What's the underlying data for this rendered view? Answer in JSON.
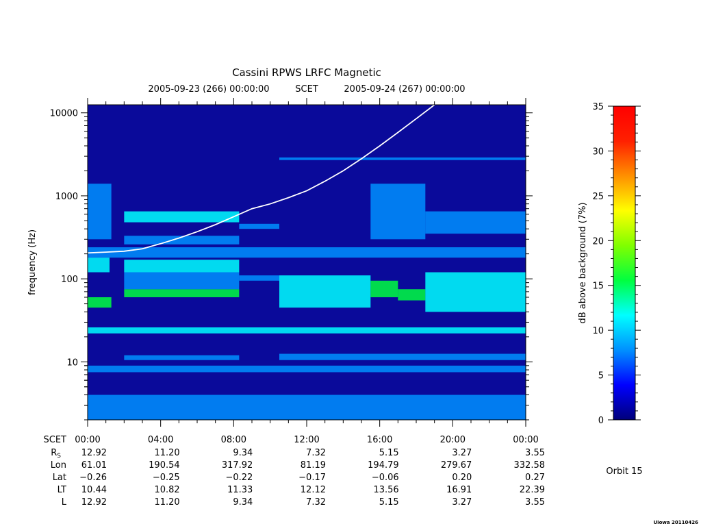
{
  "chart_data": {
    "type": "heatmap",
    "title": "Cassini RPWS LRFC Magnetic",
    "subtitle": {
      "start": "2005-09-23 (266) 00:00:00",
      "mid": "SCET",
      "end": "2005-09-24 (267) 00:00:00"
    },
    "ylabel": "frequency (Hz)",
    "yscale": "log",
    "ylim": [
      2,
      12500
    ],
    "y_ticks": [
      {
        "value": 10,
        "label": "10"
      },
      {
        "value": 100,
        "label": "100"
      },
      {
        "value": 1000,
        "label": "1000"
      },
      {
        "value": 10000,
        "label": "10000"
      }
    ],
    "xlim_hours": [
      0,
      24
    ],
    "colorbar": {
      "label": "dB above background (7%)",
      "range": [
        0,
        35
      ],
      "ticks": [
        "0",
        "5",
        "10",
        "15",
        "20",
        "25",
        "30",
        "35"
      ],
      "colors": [
        "#00007a",
        "#0000ff",
        "#0090ff",
        "#00ffff",
        "#00ff40",
        "#80ff00",
        "#ffff00",
        "#ff9000",
        "#ff2000",
        "#ff0000"
      ]
    },
    "ephemeris_labels": [
      "SCET",
      "R",
      "Lon",
      "Lat",
      "LT",
      "L"
    ],
    "ephemeris_subscript": "S",
    "ephemeris": {
      "SCET": [
        "00:00",
        "04:00",
        "08:00",
        "12:00",
        "16:00",
        "20:00",
        "00:00"
      ],
      "Rs": [
        "12.92",
        "11.20",
        "9.34",
        "7.32",
        "5.15",
        "3.27",
        "3.55"
      ],
      "Lon": [
        "61.01",
        "190.54",
        "317.92",
        "81.19",
        "194.79",
        "279.67",
        "332.58"
      ],
      "Lat": [
        "−0.26",
        "−0.25",
        "−0.22",
        "−0.17",
        "−0.06",
        "0.20",
        "0.27"
      ],
      "LT": [
        "10.44",
        "10.82",
        "11.33",
        "12.12",
        "13.56",
        "16.91",
        "22.39"
      ],
      "L": [
        "12.92",
        "11.20",
        "9.34",
        "7.32",
        "5.15",
        "3.27",
        "3.55"
      ]
    },
    "electron_cyclotron_line": {
      "x_hours": [
        0,
        1,
        2,
        3,
        4,
        5,
        6,
        7,
        8,
        9,
        10,
        11,
        12,
        13,
        14,
        15,
        16,
        17,
        18,
        19
      ],
      "y_hz": [
        205,
        210,
        215,
        230,
        265,
        310,
        370,
        450,
        560,
        700,
        800,
        950,
        1150,
        1500,
        2000,
        2800,
        4000,
        5800,
        8500,
        12500
      ]
    },
    "bands": [
      {
        "x": [
          0,
          24
        ],
        "y": [
          2,
          4
        ],
        "level": 7
      },
      {
        "x": [
          0,
          24
        ],
        "y": [
          7.5,
          9
        ],
        "level": 8
      },
      {
        "x": [
          0,
          24
        ],
        "y": [
          22,
          26
        ],
        "level": 11
      },
      {
        "x": [
          0,
          24
        ],
        "y": [
          180,
          240
        ],
        "level": 6
      },
      {
        "x": [
          0,
          1.3
        ],
        "y": [
          45,
          60
        ],
        "level": 16
      },
      {
        "x": [
          0,
          1.2
        ],
        "y": [
          120,
          180
        ],
        "level": 10
      },
      {
        "x": [
          0,
          1.3
        ],
        "y": [
          300,
          1400
        ],
        "level": 6
      },
      {
        "x": [
          2,
          8.3
        ],
        "y": [
          60,
          75
        ],
        "level": 14
      },
      {
        "x": [
          2,
          8.3
        ],
        "y": [
          120,
          170
        ],
        "level": 11
      },
      {
        "x": [
          2,
          8.3
        ],
        "y": [
          75,
          120
        ],
        "level": 9
      },
      {
        "x": [
          2,
          8.3
        ],
        "y": [
          480,
          650
        ],
        "level": 10
      },
      {
        "x": [
          2,
          8.3
        ],
        "y": [
          260,
          330
        ],
        "level": 9
      },
      {
        "x": [
          2,
          8.3
        ],
        "y": [
          10.5,
          12
        ],
        "level": 8
      },
      {
        "x": [
          8.3,
          10.5
        ],
        "y": [
          95,
          110
        ],
        "level": 9
      },
      {
        "x": [
          8.3,
          10.5
        ],
        "y": [
          400,
          460
        ],
        "level": 9
      },
      {
        "x": [
          10.5,
          15.5
        ],
        "y": [
          45,
          110
        ],
        "level": 13
      },
      {
        "x": [
          10.5,
          24
        ],
        "y": [
          10.5,
          12.5
        ],
        "level": 9
      },
      {
        "x": [
          15.5,
          17
        ],
        "y": [
          60,
          95
        ],
        "level": 14
      },
      {
        "x": [
          17,
          18.5
        ],
        "y": [
          55,
          75
        ],
        "level": 17
      },
      {
        "x": [
          15.5,
          18.5
        ],
        "y": [
          300,
          1400
        ],
        "level": 6
      },
      {
        "x": [
          18.5,
          24
        ],
        "y": [
          40,
          120
        ],
        "level": 11
      },
      {
        "x": [
          18.5,
          24
        ],
        "y": [
          350,
          650
        ],
        "level": 9
      },
      {
        "x": [
          10.5,
          24
        ],
        "y": [
          2700,
          2900
        ],
        "level": 7
      }
    ],
    "grid": false
  },
  "orbit_label": "Orbit 15",
  "credit": "Uiowa 20110426"
}
